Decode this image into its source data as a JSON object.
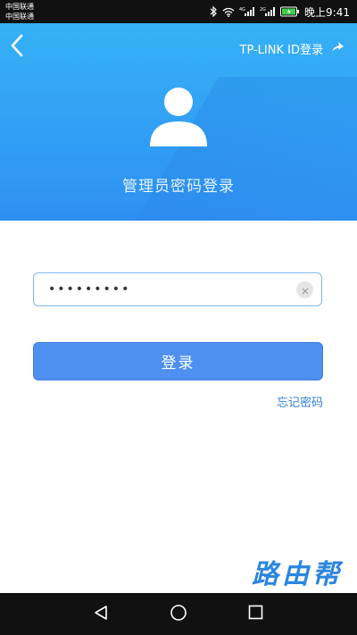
{
  "status_bar": {
    "carrier_1": "中国联通",
    "carrier_2": "中国联通",
    "time": "晚上9:41",
    "icons": [
      "bluetooth-icon",
      "wifi-icon",
      "4g-signal-icon",
      "2g-signal-icon",
      "battery-icon"
    ],
    "signal_label_1": "4G",
    "signal_label_2": "2G"
  },
  "header": {
    "back_icon": "back-chevron-icon",
    "tplink_label": "TP-LINK ID登录",
    "tplink_icon": "swipe-up-arrow-icon",
    "avatar_icon": "user-avatar-icon",
    "title": "管理员密码登录",
    "colors": {
      "top": "#36b1f6",
      "bottom": "#2e90f2"
    }
  },
  "form": {
    "password_value": "•••••••••",
    "clear_icon": "clear-icon",
    "login_label": "登录",
    "forgot_label": "忘记密码",
    "accent": "#4f8ff0"
  },
  "watermark": {
    "text": "路由帮"
  },
  "nav_bar": {
    "icons": [
      "back-triangle-icon",
      "home-circle-icon",
      "recents-square-icon"
    ]
  }
}
